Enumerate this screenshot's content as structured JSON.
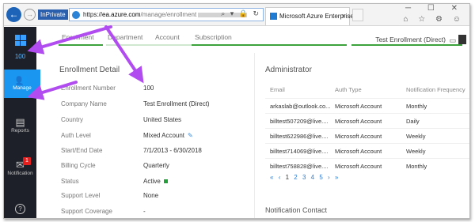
{
  "browser": {
    "inprivate_label": "InPrivate",
    "url_scheme": "https://",
    "url_host": "ea.azure.com",
    "url_path": "/manage/enrollment",
    "tab_title": "Microsoft Azure Enterprise ...",
    "tab_close": "×",
    "window_controls": "─ ☐ ✕",
    "tool_icons": "⌂ ☆ ⚙ ☺"
  },
  "leftnav": {
    "home_label": "100",
    "manage_label": "Manage",
    "reports_label": "Reports",
    "notification_label": "Notification",
    "notification_badge": "1",
    "help_glyph": "?"
  },
  "topbar": {
    "tabs": [
      {
        "label": "Enrollment"
      },
      {
        "label": "Department"
      },
      {
        "label": "Account"
      },
      {
        "label": "Subscription"
      }
    ],
    "enrollment_select": "Test Enrollment (Direct)"
  },
  "enrollment_detail": {
    "title": "Enrollment Detail",
    "rows": [
      {
        "label": "Enrollment Number",
        "value": "100"
      },
      {
        "label": "Company Name",
        "value": "Test Enrollment (Direct)"
      },
      {
        "label": "Country",
        "value": "United States"
      },
      {
        "label": "Auth Level",
        "value": "Mixed Account"
      },
      {
        "label": "Start/End Date",
        "value": "7/1/2013 - 6/30/2018"
      },
      {
        "label": "Billing Cycle",
        "value": "Quarterly"
      },
      {
        "label": "Status",
        "value": "Active"
      },
      {
        "label": "Support Level",
        "value": "None"
      },
      {
        "label": "Support Coverage",
        "value": "-"
      }
    ]
  },
  "administrator": {
    "title": "Administrator",
    "columns": [
      "Email",
      "Auth Type",
      "Notification Frequency"
    ],
    "rows": [
      {
        "email": "arkaslab@outlook.co...",
        "auth": "Microsoft Account",
        "freq": "Monthly"
      },
      {
        "email": "billtest507209@live....",
        "auth": "Microsoft Account",
        "freq": "Daily"
      },
      {
        "email": "billtest622986@live....",
        "auth": "Microsoft Account",
        "freq": "Weekly"
      },
      {
        "email": "billtest714069@live....",
        "auth": "Microsoft Account",
        "freq": "Weekly"
      },
      {
        "email": "billtest758828@live....",
        "auth": "Microsoft Account",
        "freq": "Monthly"
      }
    ],
    "pager": {
      "first": "«",
      "prev": "‹",
      "pages": [
        "1",
        "2",
        "3",
        "4",
        "5"
      ],
      "next": "›",
      "last": "»"
    }
  },
  "notification_contact": {
    "title": "Notification Contact"
  },
  "colors": {
    "accent": "#1a96f0",
    "nav_bg": "#1d2028",
    "active_green": "#23a03a",
    "annotation": "#b04cf0"
  }
}
